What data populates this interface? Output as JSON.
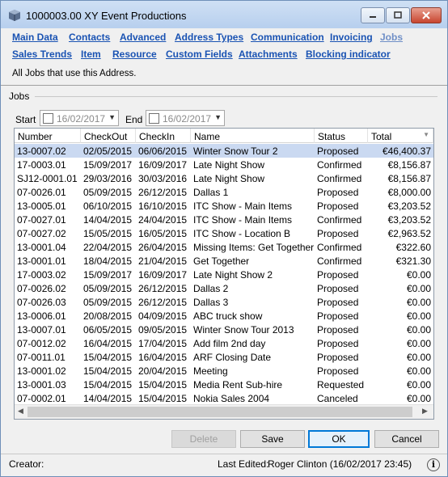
{
  "window": {
    "title": "1000003.00 XY Event Productions"
  },
  "tabs": [
    "Main Data",
    "Contacts",
    "Advanced",
    "Address Types",
    "Communication",
    "Invoicing",
    "Jobs",
    "Sales Trends",
    "Item",
    "Resource",
    "Custom Fields",
    "Attachments",
    "Blocking indicator"
  ],
  "description": "All Jobs that use this Address.",
  "group": {
    "label": "Jobs"
  },
  "filter": {
    "start_label": "Start",
    "start_value": "16/02/2017",
    "end_label": "End",
    "end_value": "16/02/2017"
  },
  "table": {
    "columns": [
      "Number",
      "CheckOut",
      "CheckIn",
      "Name",
      "Status",
      "Total"
    ],
    "rows": [
      [
        "13-0007.02",
        "02/05/2015",
        "06/06/2015",
        "Winter Snow Tour 2",
        "Proposed",
        "€46,400.37"
      ],
      [
        "17-0003.01",
        "15/09/2017",
        "16/09/2017",
        "Late Night Show",
        "Confirmed",
        "€8,156.87"
      ],
      [
        "SJ12-0001.01",
        "29/03/2016",
        "30/03/2016",
        "Late Night Show",
        "Confirmed",
        "€8,156.87"
      ],
      [
        "07-0026.01",
        "05/09/2015",
        "26/12/2015",
        "Dallas 1",
        "Proposed",
        "€8,000.00"
      ],
      [
        "13-0005.01",
        "06/10/2015",
        "16/10/2015",
        "ITC Show - Main Items",
        "Proposed",
        "€3,203.52"
      ],
      [
        "07-0027.01",
        "14/04/2015",
        "24/04/2015",
        "ITC Show - Main Items",
        "Confirmed",
        "€3,203.52"
      ],
      [
        "07-0027.02",
        "15/05/2015",
        "16/05/2015",
        "ITC Show - Location B",
        "Proposed",
        "€2,963.52"
      ],
      [
        "13-0001.04",
        "22/04/2015",
        "26/04/2015",
        "Missing Items: Get Together",
        "Confirmed",
        "€322.60"
      ],
      [
        "13-0001.01",
        "18/04/2015",
        "21/04/2015",
        "Get Together",
        "Confirmed",
        "€321.30"
      ],
      [
        "17-0003.02",
        "15/09/2017",
        "16/09/2017",
        "Late Night Show 2",
        "Proposed",
        "€0.00"
      ],
      [
        "07-0026.02",
        "05/09/2015",
        "26/12/2015",
        "Dallas 2",
        "Proposed",
        "€0.00"
      ],
      [
        "07-0026.03",
        "05/09/2015",
        "26/12/2015",
        "Dallas 3",
        "Proposed",
        "€0.00"
      ],
      [
        "13-0006.01",
        "20/08/2015",
        "04/09/2015",
        "ABC truck show",
        "Proposed",
        "€0.00"
      ],
      [
        "13-0007.01",
        "06/05/2015",
        "09/05/2015",
        "Winter Snow Tour 2013",
        "Proposed",
        "€0.00"
      ],
      [
        "07-0012.02",
        "16/04/2015",
        "17/04/2015",
        "Add film 2nd day",
        "Proposed",
        "€0.00"
      ],
      [
        "07-0011.01",
        "15/04/2015",
        "16/04/2015",
        "ARF Closing Date",
        "Proposed",
        "€0.00"
      ],
      [
        "13-0001.02",
        "15/04/2015",
        "20/04/2015",
        "Meeting",
        "Proposed",
        "€0.00"
      ],
      [
        "13-0001.03",
        "15/04/2015",
        "15/04/2015",
        "Media Rent Sub-hire",
        "Requested",
        "€0.00"
      ],
      [
        "07-0002.01",
        "14/04/2015",
        "15/04/2015",
        "Nokia Sales 2004",
        "Canceled",
        "€0.00"
      ]
    ]
  },
  "buttons": {
    "delete": "Delete",
    "save": "Save",
    "ok": "OK",
    "cancel": "Cancel"
  },
  "status": {
    "creator_label": "Creator:",
    "last_edited_label": "Last Edited:",
    "last_edited_value": "Roger Clinton (16/02/2017 23:45)"
  }
}
